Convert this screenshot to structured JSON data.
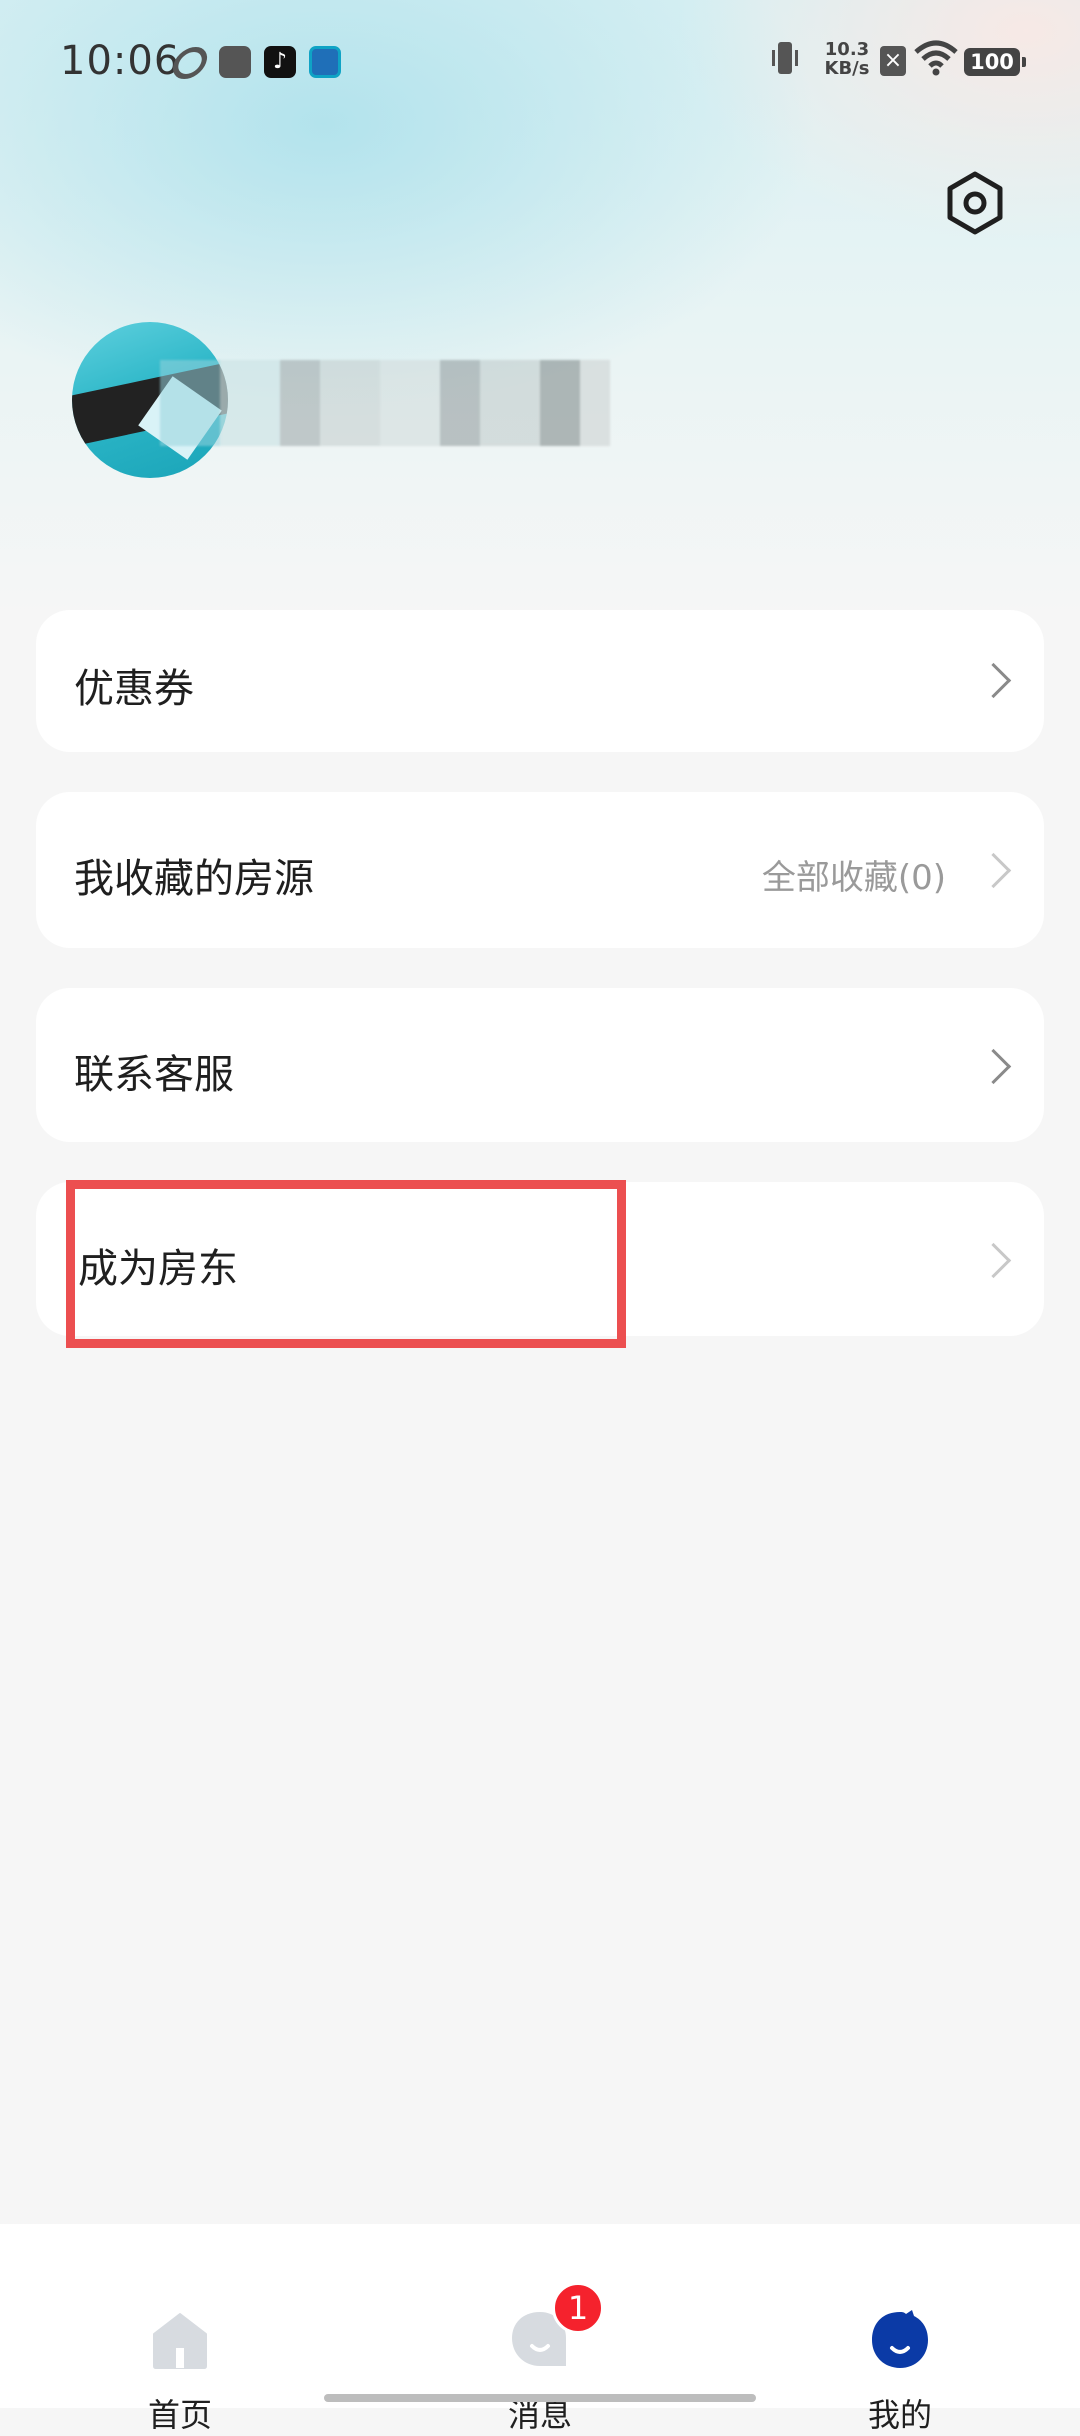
{
  "status_bar": {
    "time": "10:06",
    "net_speed_value": "10.3",
    "net_speed_unit": "KB/s",
    "battery": "100"
  },
  "menu": {
    "coupons_label": "优惠券",
    "favorites_label": "我收藏的房源",
    "favorites_extra": "全部收藏(0)",
    "support_label": "联系客服",
    "landlord_label": "成为房东"
  },
  "tabs": {
    "home_label": "首页",
    "messages_label": "消息",
    "messages_badge": "1",
    "mine_label": "我的"
  },
  "colors": {
    "accent_active_tab": "#0b3aa6",
    "badge": "#f5222d",
    "highlight_box": "#ec4f50"
  }
}
